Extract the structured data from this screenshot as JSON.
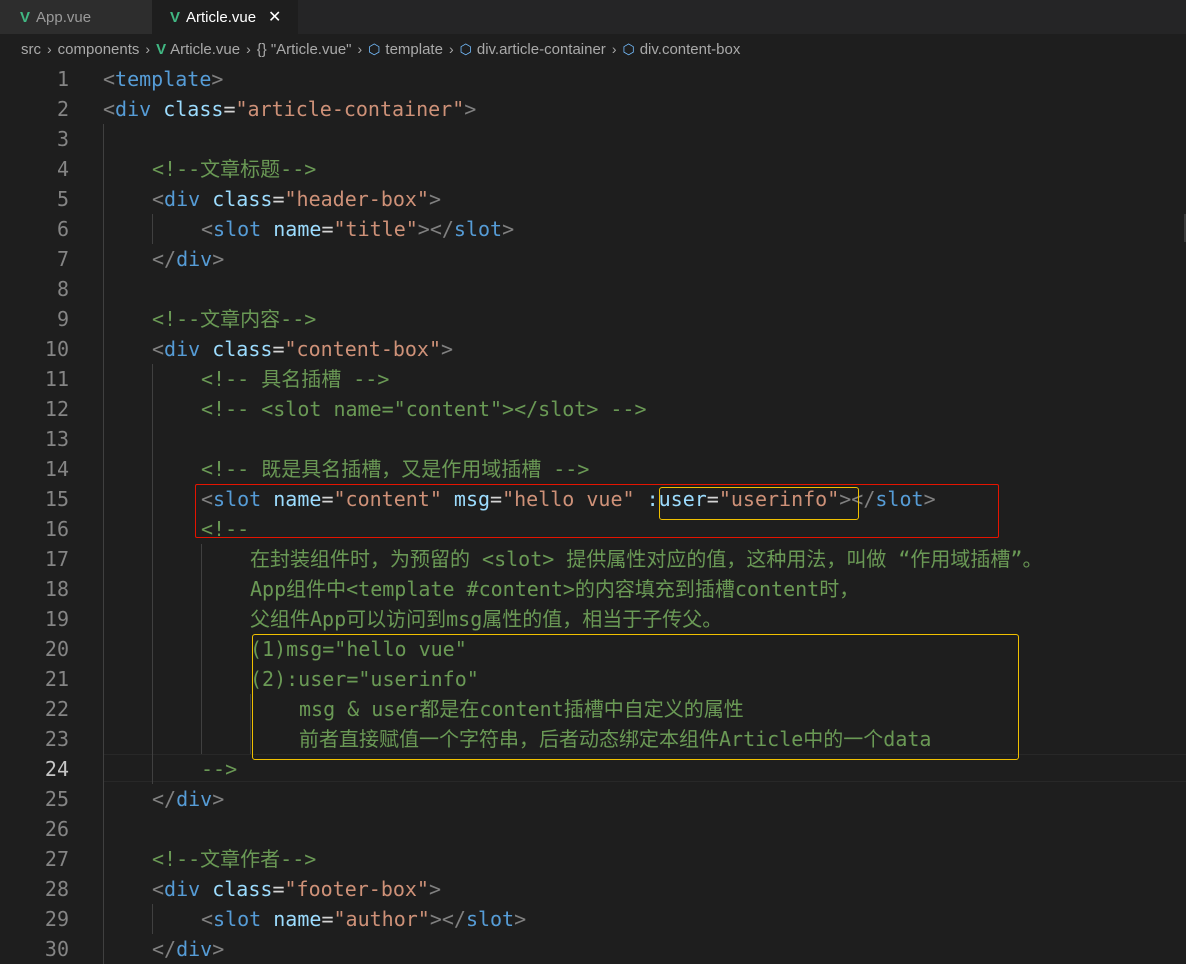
{
  "tabs": [
    {
      "label": "App.vue",
      "icon": "vue-icon",
      "active": false
    },
    {
      "label": "Article.vue",
      "icon": "vue-icon",
      "active": true,
      "close": "✕"
    }
  ],
  "breadcrumb": {
    "src": "src",
    "components": "components",
    "file": "Article.vue",
    "braces": "{}",
    "component": "\"Article.vue\"",
    "template": "template",
    "container": "div.article-container",
    "contentbox": "div.content-box"
  },
  "editor": {
    "current_line": 24,
    "line_numbers": [
      "1",
      "2",
      "3",
      "4",
      "5",
      "6",
      "7",
      "8",
      "9",
      "10",
      "11",
      "12",
      "13",
      "14",
      "15",
      "16",
      "17",
      "18",
      "19",
      "20",
      "21",
      "22",
      "23",
      "24",
      "25",
      "26",
      "27",
      "28",
      "29",
      "30"
    ]
  },
  "code": {
    "l1": {
      "tag": "template"
    },
    "l2": {
      "tag": "div",
      "attr": "class",
      "val": "\"article-container\""
    },
    "l4": {
      "comment": "<!--文章标题-->"
    },
    "l5": {
      "tag": "div",
      "attr": "class",
      "val": "\"header-box\""
    },
    "l6": {
      "tag": "slot",
      "attr": "name",
      "val": "\"title\""
    },
    "l7": {
      "tag": "div"
    },
    "l9": {
      "comment": "<!--文章内容-->"
    },
    "l10": {
      "tag": "div",
      "attr": "class",
      "val": "\"content-box\""
    },
    "l11": {
      "comment": "<!-- 具名插槽 -->"
    },
    "l12": {
      "comment": "<!-- <slot name=\"content\"></slot> -->"
    },
    "l14": {
      "comment": "<!-- 既是具名插槽，又是作用域插槽 -->"
    },
    "l15": {
      "tag": "slot",
      "attr1": "name",
      "val1": "\"content\"",
      "attr2": "msg",
      "val2": "\"hello vue\"",
      "attr3": ":user",
      "val3": "\"userinfo\""
    },
    "l16": {
      "comment": "<!--"
    },
    "l17": {
      "comment": "在封装组件时，为预留的 <slot> 提供属性对应的值，这种用法，叫做 “作用域插槽”。"
    },
    "l18": {
      "comment": "App组件中<template #content>的内容填充到插槽content时，"
    },
    "l19": {
      "comment": "父组件App可以访问到msg属性的值，相当于子传父。"
    },
    "l20": {
      "comment": "(1)msg=\"hello vue\""
    },
    "l21": {
      "comment": "(2):user=\"userinfo\""
    },
    "l22": {
      "comment": "msg & user都是在content插槽中自定义的属性"
    },
    "l23": {
      "comment": "前者直接赋值一个字符串，后者动态绑定本组件Article中的一个data"
    },
    "l24": {
      "comment": "-->"
    },
    "l25": {
      "tag": "div"
    },
    "l27": {
      "comment": "<!--文章作者-->"
    },
    "l28": {
      "tag": "div",
      "attr": "class",
      "val": "\"footer-box\""
    },
    "l29": {
      "tag": "slot",
      "attr": "name",
      "val": "\"author\""
    },
    "l30": {
      "tag": "div"
    }
  },
  "colors": {
    "highlight_red": "#e51400",
    "highlight_yellow": "#f0c000",
    "vue_green": "#41b883"
  }
}
